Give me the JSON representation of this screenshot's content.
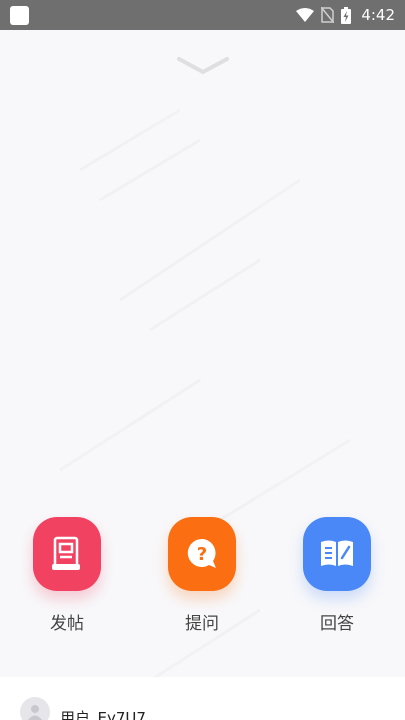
{
  "status_bar": {
    "time": "4:42"
  },
  "actions": [
    {
      "label": "发帖",
      "color": "#f14262",
      "icon": "post-document-icon"
    },
    {
      "label": "提问",
      "color": "#fb6e11",
      "icon": "question-bubble-icon"
    },
    {
      "label": "回答",
      "color": "#4a88f7",
      "icon": "open-book-icon"
    }
  ],
  "bottom_card": {
    "user_name": "用户_Ey7U7"
  }
}
